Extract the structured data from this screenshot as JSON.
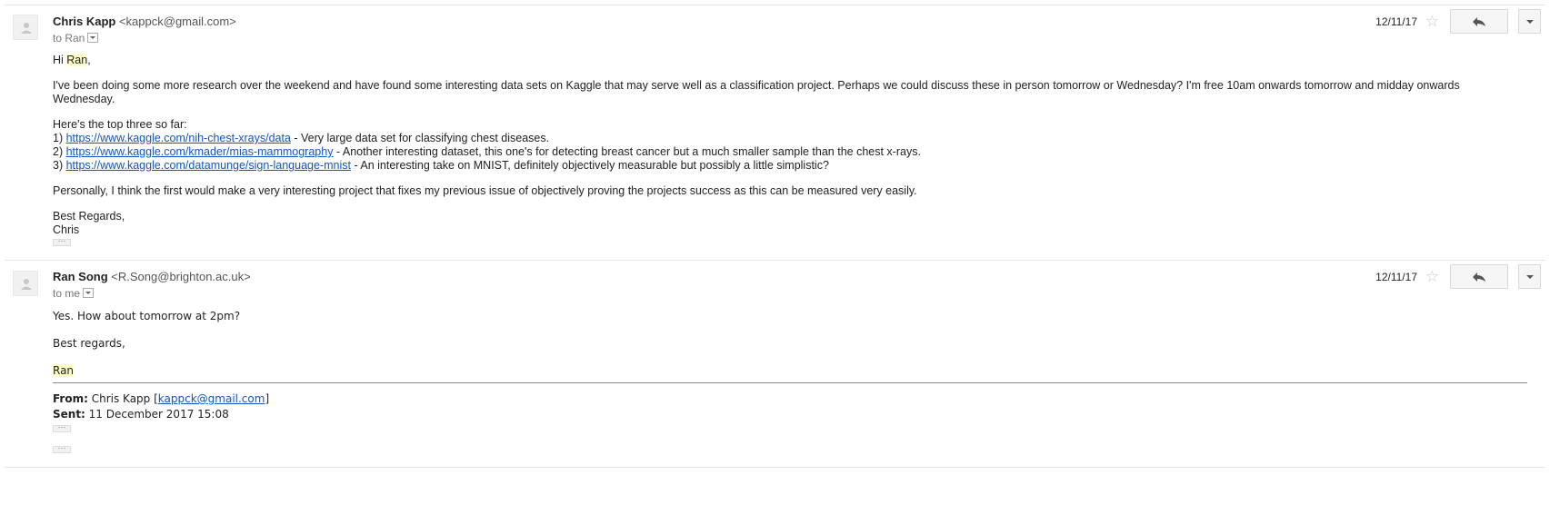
{
  "messages": [
    {
      "sender_name": "Chris Kapp",
      "sender_email": "<kappck@gmail.com>",
      "to_line": "to Ran",
      "date": "12/11/17",
      "greeting_pre": "Hi ",
      "greeting_name": "Ran",
      "greeting_post": ",",
      "para1": "I've been doing some more research over the weekend and have found some interesting data sets on Kaggle that may serve well as a classification project. Perhaps we could discuss these in person tomorrow or Wednesday? I'm free 10am onwards tomorrow and midday onwards Wednesday.",
      "list_intro": "Here's the top three so far:",
      "links": [
        {
          "num": "1) ",
          "url": "https://www.kaggle.com/nih-chest-xrays/data",
          "desc": " - Very large data set for classifying chest diseases."
        },
        {
          "num": "2) ",
          "url": "https://www.kaggle.com/kmader/mias-mammography",
          "desc": " - Another interesting dataset, this one's for detecting breast cancer but a much smaller sample than the chest x-rays."
        },
        {
          "num": "3) ",
          "url": "https://www.kaggle.com/datamunge/sign-language-mnist",
          "desc": " - An interesting take on MNIST, definitely objectively measurable but possibly a little simplistic?"
        }
      ],
      "para2": "Personally, I think the first would make a very interesting project that fixes my previous issue of objectively proving the projects success as this can be measured very easily.",
      "signoff": "Best Regards,",
      "signature": "Chris",
      "ellipsis": "···"
    },
    {
      "sender_name": "Ran Song",
      "sender_email": "<R.Song@brighton.ac.uk>",
      "to_line": "to me",
      "date": "12/11/17",
      "line1": "Yes. How about tomorrow at 2pm?",
      "signoff": "Best regards,",
      "signature": "Ran",
      "from_label": "From:",
      "from_value": " Chris Kapp [",
      "from_email": "kappck@gmail.com",
      "from_close": "]",
      "sent_label": "Sent:",
      "sent_value": " 11 December 2017 15:08",
      "ellipsis": "···"
    }
  ],
  "icons": {
    "avatar": "person-silhouette-icon",
    "star": "star-icon",
    "reply": "reply-arrow-icon",
    "more": "chevron-down-icon"
  },
  "colors": {
    "link": "#1155cc",
    "highlight": "#ffffcc"
  }
}
